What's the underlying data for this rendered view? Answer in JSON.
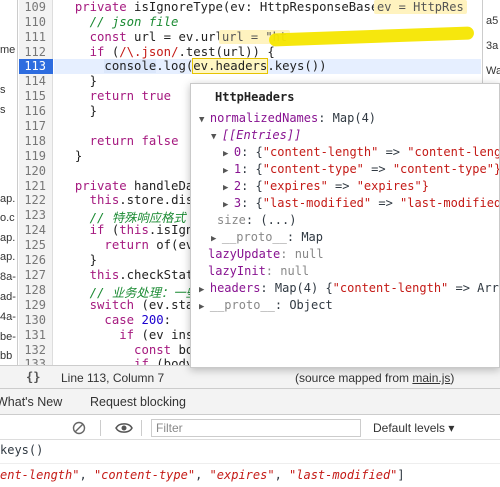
{
  "left_tree": [
    "me",
    "s",
    "s",
    "ap.",
    "o.c",
    "ap.",
    "ap.",
    "8a-",
    "ad-",
    "4a-",
    "be-",
    "bb"
  ],
  "right_panel": [
    "a5",
    "3a",
    "Wa"
  ],
  "gutter": {
    "lines": [
      "109",
      "110",
      "111",
      "112",
      "113",
      "114",
      "115",
      "116",
      "117",
      "118",
      "119",
      "120",
      "121",
      "122",
      "123",
      "124",
      "125",
      "126",
      "127",
      "128",
      "129",
      "130",
      "131",
      "132",
      "133"
    ],
    "active": "113"
  },
  "code": {
    "l109_kw": "private",
    "l109_rest": " isIgnoreType(ev: HttpResponseBase) {",
    "l109_inline": "ev = HttpRes",
    "l110": "// json file",
    "l111_kw": "const",
    "l111_rest": " url = ev.url",
    "l111_inline": "url = \"ht",
    "l112_kw": "if",
    "l112_a": " (",
    "l112_regex": "/\\.json/",
    "l112_b": ".test(url)) {",
    "l113_a": "console",
    "l113_b": ".log(",
    "l113_c": "ev.headers",
    "l113_d": ".keys())",
    "l114": "}",
    "l115_kw": "return",
    "l115_val": " true",
    "l116": "}",
    "l118_kw": "return",
    "l118_val": " false",
    "l119": "}",
    "l121_kw": "private",
    "l121_rest": " handleData",
    "l122_a": "this",
    "l122_b": ".store.dispa",
    "l123": "// 特殊响应格式",
    "l124_kw": "if",
    "l124_a": " (",
    "l124_b": "this",
    "l124_c": ".isIgnor",
    "l125_kw": "return",
    "l125_rest": " of(ev)",
    "l126": "}",
    "l127_a": "this",
    "l127_b": ".checkStatus",
    "l128": "// 业务处理：一些通",
    "l129_kw": "switch",
    "l129_rest": " (ev.status",
    "l130_kw": "case",
    "l130_num": " 200",
    "l130_rest": ":",
    "l131_kw": "if",
    "l131_rest": " (ev insta",
    "l132_kw": "const",
    "l132_rest": " body",
    "l133_kw": "if",
    "l133_rest": " (body &"
  },
  "popover": {
    "title": "HttpHeaders",
    "normalized_key": "normalizedNames",
    "normalized_val": ": Map(4)",
    "entries_label": "[[Entries]]",
    "entries": [
      {
        "idx": "0",
        "k": "\"content-length\"",
        "v": "\"content-lengtl"
      },
      {
        "idx": "1",
        "k": "\"content-type\"",
        "v": "\"content-type\"}"
      },
      {
        "idx": "2",
        "k": "\"expires\"",
        "v": "\"expires\"}"
      },
      {
        "idx": "3",
        "k": "\"last-modified\"",
        "v": "\"last-modified\""
      }
    ],
    "size_key": "size",
    "size_val": ": (...)",
    "proto1_key": "__proto__",
    "proto1_val": ": Map",
    "lazyupdate_key": "lazyUpdate",
    "lazyupdate_val": ": null",
    "lazyinit_key": "lazyInit",
    "lazyinit_val": ": null",
    "headers_key": "headers",
    "headers_val": ": Map(4) {",
    "headers_str": "\"content-length\"",
    "headers_tail": " => Array",
    "proto2_key": "__proto__",
    "proto2_val": ": Object"
  },
  "statusbar": {
    "braces": "{}",
    "position": "Line 113, Column 7",
    "source_prefix": "(source mapped from ",
    "source_file": "main.js",
    "source_suffix": ")"
  },
  "tabs": [
    "What's New",
    "Request blocking"
  ],
  "console_toolbar": {
    "filter_placeholder": "Filter",
    "levels": "Default levels ▾"
  },
  "console_output": {
    "line1": "keys()",
    "line2_parts": [
      "ent-length\"",
      ", ",
      "\"content-type\"",
      ", ",
      "\"expires\"",
      ", ",
      "\"last-modified\"",
      "]"
    ]
  },
  "colors": {
    "accent": "#2d6cdf",
    "highlight": "#f5e600",
    "string": "#c41a16",
    "keyword": "#a5197f",
    "comment": "#1a8a32"
  }
}
